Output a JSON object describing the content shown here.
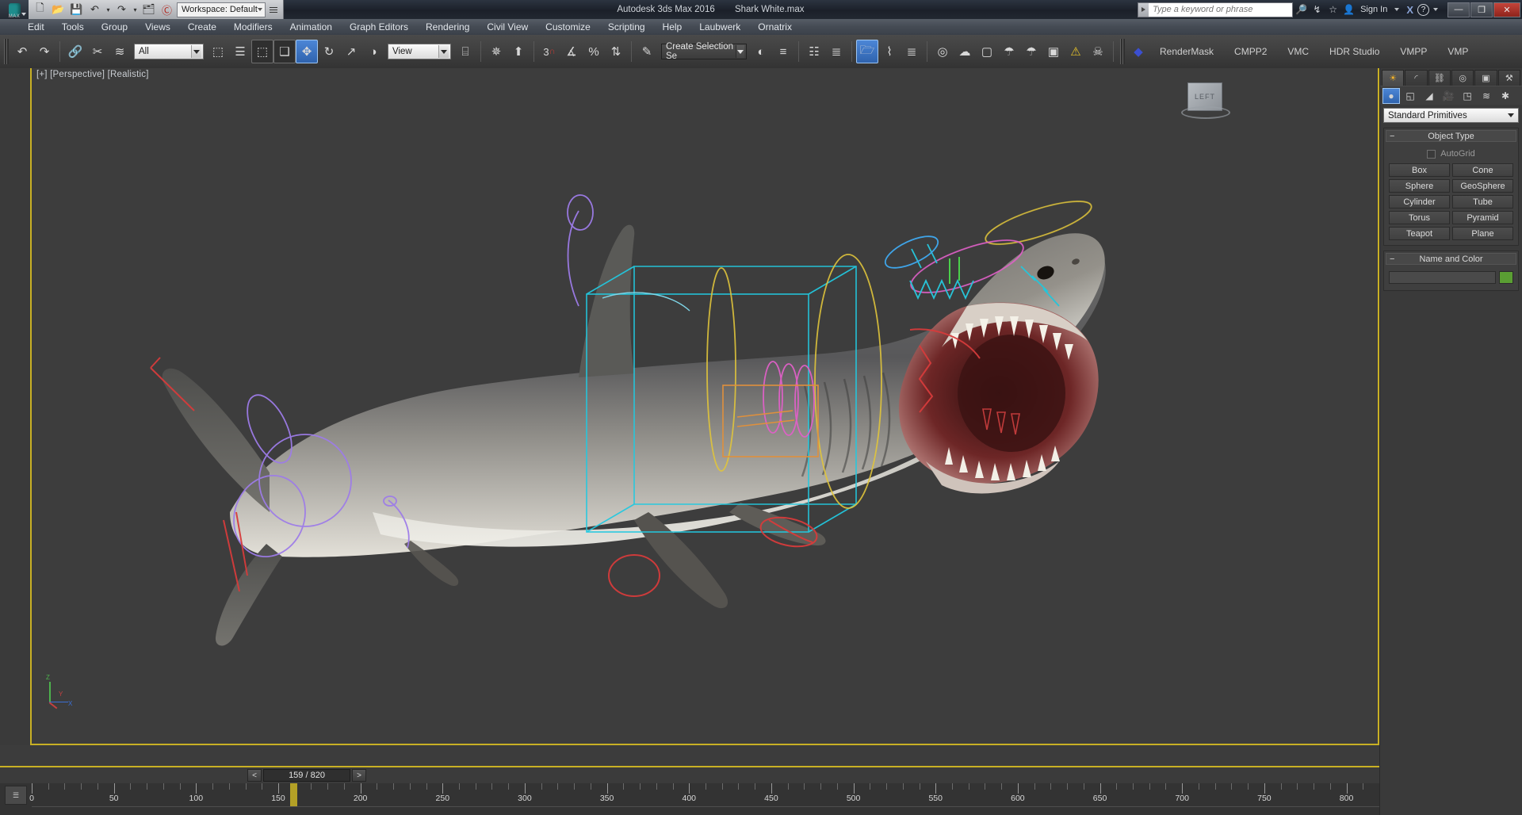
{
  "titlebar": {
    "app_title": "Autodesk 3ds Max 2016",
    "file_name": "Shark White.max",
    "workspace": "Workspace: Default",
    "search_placeholder": "Type a keyword or phrase",
    "sign_in": "Sign In",
    "quick_access": [
      {
        "name": "new-file-icon",
        "glyph": "🗋"
      },
      {
        "name": "open-file-icon",
        "glyph": "📂"
      },
      {
        "name": "save-file-icon",
        "glyph": "💾"
      },
      {
        "name": "undo-icon",
        "glyph": "↶"
      },
      {
        "name": "undo-dropdown-icon",
        "glyph": "▾"
      },
      {
        "name": "redo-icon",
        "glyph": "↷"
      },
      {
        "name": "redo-dropdown-icon",
        "glyph": "▾"
      },
      {
        "name": "project-folder-icon",
        "glyph": "🗂"
      },
      {
        "name": "autodesk-360-icon",
        "glyph": "Ⓒ"
      }
    ],
    "right_icons": [
      {
        "name": "binoculars-icon",
        "glyph": "🔎"
      },
      {
        "name": "satellite-dish-icon",
        "glyph": "↯"
      },
      {
        "name": "favorites-star-icon",
        "glyph": "☆"
      },
      {
        "name": "user-account-icon",
        "glyph": "👤"
      }
    ],
    "window_buttons": [
      {
        "name": "minimize-button",
        "glyph": "—"
      },
      {
        "name": "restore-button",
        "glyph": "❐"
      },
      {
        "name": "close-button",
        "glyph": "✕"
      }
    ],
    "max_logo_text": "MAX"
  },
  "menubar": {
    "items": [
      "Edit",
      "Tools",
      "Group",
      "Views",
      "Create",
      "Modifiers",
      "Animation",
      "Graph Editors",
      "Rendering",
      "Civil View",
      "Customize",
      "Scripting",
      "Help",
      "Laubwerk",
      "Ornatrix"
    ]
  },
  "toolbar": {
    "selection_filter": "All",
    "reference_coord": "View",
    "named_selection_set": "Create Selection Se",
    "snap_angle": "3",
    "plugin_menus": [
      "RenderMask",
      "CMPP2",
      "VMC",
      "HDR Studio",
      "VMPP",
      "VMP"
    ],
    "buttons": [
      {
        "name": "undo-button",
        "glyph": "↶"
      },
      {
        "name": "redo-button",
        "glyph": "↷"
      },
      {
        "name": "select-link-button",
        "glyph": "🔗"
      },
      {
        "name": "unlink-selection-button",
        "glyph": "✂"
      },
      {
        "name": "bind-to-spacewarp-button",
        "glyph": "≋"
      },
      {
        "name": "select-object-button",
        "glyph": "⬚"
      },
      {
        "name": "select-by-name-button",
        "glyph": "☰"
      },
      {
        "name": "rectangular-region-button",
        "glyph": "⬚"
      },
      {
        "name": "window-crossing-button",
        "glyph": "❑"
      },
      {
        "name": "select-and-move-button",
        "glyph": "✥"
      },
      {
        "name": "select-and-rotate-button",
        "glyph": "↻"
      },
      {
        "name": "select-and-scale-button",
        "glyph": "↗"
      },
      {
        "name": "reference-coord-icon",
        "glyph": "◑"
      },
      {
        "name": "use-pivot-center-button",
        "glyph": "⌸"
      },
      {
        "name": "select-and-manipulate-button",
        "glyph": "✵"
      },
      {
        "name": "keyboard-shortcut-override-button",
        "glyph": "⬆"
      },
      {
        "name": "snaps-toggle-button",
        "glyph": "⊓"
      },
      {
        "name": "angle-snap-button",
        "glyph": "∡"
      },
      {
        "name": "percent-snap-button",
        "glyph": "%"
      },
      {
        "name": "spinner-snap-button",
        "glyph": "⇅"
      },
      {
        "name": "edit-named-selection-button",
        "glyph": "✎"
      },
      {
        "name": "mirror-button",
        "glyph": "◐"
      },
      {
        "name": "align-button",
        "glyph": "≡"
      },
      {
        "name": "layer-manager-button",
        "glyph": "☷"
      },
      {
        "name": "scene-explorer-button",
        "glyph": "≣"
      },
      {
        "name": "toggle-ribbon-button",
        "glyph": "🗁"
      },
      {
        "name": "curve-editor-button",
        "glyph": "⌇"
      },
      {
        "name": "schematic-view-button",
        "glyph": "≣"
      },
      {
        "name": "material-editor-button",
        "glyph": "◎"
      },
      {
        "name": "render-setup-button",
        "glyph": "☁"
      },
      {
        "name": "rendered-frame-window-button",
        "glyph": "▢"
      },
      {
        "name": "render-production-button",
        "glyph": "☂"
      },
      {
        "name": "render-iterative-button",
        "glyph": "☂"
      },
      {
        "name": "render-in-cloud-button",
        "glyph": "⛅"
      },
      {
        "name": "open-asset-tracking-button",
        "glyph": "▣"
      },
      {
        "name": "warning-icon",
        "glyph": "⚠"
      },
      {
        "name": "skull-plugin-icon",
        "glyph": "☠"
      },
      {
        "name": "rendermask-plugin-icon",
        "glyph": "◆"
      }
    ]
  },
  "viewport": {
    "label": "[+] [Perspective] [Realistic]",
    "viewcube_face": "LEFT",
    "axis_labels": {
      "x": "X",
      "y": "Y",
      "z": "Z"
    }
  },
  "time_slider": {
    "current_frame": 159,
    "total_frames": 820,
    "display": "159 / 820",
    "prev_label": "<",
    "next_label": ">"
  },
  "track_bar": {
    "tick_labels": [
      0,
      50,
      100,
      150,
      200,
      250,
      300,
      350,
      400,
      450,
      500,
      550,
      600,
      650,
      700,
      750,
      800
    ],
    "range_start": 0,
    "range_end": 820,
    "playhead_frame": 159,
    "open_mini_curve_editor_icon": "track-bar-toggle-icon"
  },
  "command_panel": {
    "tabs": [
      {
        "name": "create-tab",
        "glyph": "☀",
        "active": true
      },
      {
        "name": "modify-tab",
        "glyph": "◜"
      },
      {
        "name": "hierarchy-tab",
        "glyph": "⛓"
      },
      {
        "name": "motion-tab",
        "glyph": "◎"
      },
      {
        "name": "display-tab",
        "glyph": "▣"
      },
      {
        "name": "utilities-tab",
        "glyph": "⚒"
      }
    ],
    "subtabs": [
      {
        "name": "geometry-subtab",
        "glyph": "●",
        "active": true
      },
      {
        "name": "shapes-subtab",
        "glyph": "◱"
      },
      {
        "name": "lights-subtab",
        "glyph": "◢"
      },
      {
        "name": "cameras-subtab",
        "glyph": "🎥"
      },
      {
        "name": "helpers-subtab",
        "glyph": "◳"
      },
      {
        "name": "space-warps-subtab",
        "glyph": "≋"
      },
      {
        "name": "systems-subtab",
        "glyph": "✱"
      }
    ],
    "category_value": "Standard Primitives",
    "object_type": {
      "title": "Object Type",
      "autogrid_label": "AutoGrid",
      "autogrid_checked": false,
      "buttons": [
        "Box",
        "Cone",
        "Sphere",
        "GeoSphere",
        "Cylinder",
        "Tube",
        "Torus",
        "Pyramid",
        "Teapot",
        "Plane"
      ]
    },
    "name_and_color": {
      "title": "Name and Color",
      "name_value": "",
      "color_hex": "#5a9e33"
    }
  },
  "colors": {
    "accent_yellow": "#c8b024",
    "viewport_bg": "#3d3d3d",
    "panel_bg": "#3a3a3a",
    "highlight_blue": "#3f79c8"
  }
}
